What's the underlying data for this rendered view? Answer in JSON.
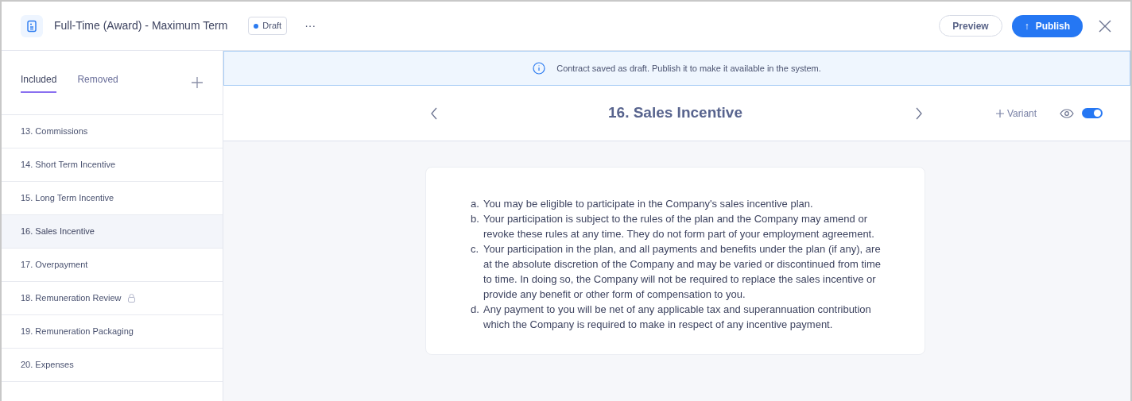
{
  "header": {
    "title": "Full-Time (Award) - Maximum Term",
    "status": "Draft",
    "more": "···",
    "preview": "Preview",
    "publish": "Publish",
    "publish_arrow": "↑"
  },
  "sidebar": {
    "tabs": [
      {
        "label": "Included",
        "selected": true
      },
      {
        "label": "Removed",
        "selected": false
      }
    ],
    "items": [
      {
        "label": "13. Commissions",
        "selected": false,
        "locked": false
      },
      {
        "label": "14. Short Term Incentive",
        "selected": false,
        "locked": false
      },
      {
        "label": "15. Long Term Incentive",
        "selected": false,
        "locked": false
      },
      {
        "label": "16. Sales Incentive",
        "selected": true,
        "locked": false
      },
      {
        "label": "17. Overpayment",
        "selected": false,
        "locked": false
      },
      {
        "label": "18. Remuneration Review",
        "selected": false,
        "locked": true
      },
      {
        "label": "19. Remuneration Packaging",
        "selected": false,
        "locked": false
      },
      {
        "label": "20. Expenses",
        "selected": false,
        "locked": false
      }
    ]
  },
  "banner": "Contract saved as draft. Publish it to make it available in the system.",
  "clause": {
    "title": "16. Sales Incentive",
    "variant": "Variant",
    "visible": true,
    "paragraphs": [
      {
        "marker": "a.",
        "text": "You may be eligible to participate in the Company's sales incentive plan."
      },
      {
        "marker": "b.",
        "text": "Your participation is subject to the rules of the plan and the Company may amend or revoke these rules at any time. They do not form part of your employment agreement."
      },
      {
        "marker": "c.",
        "text": "Your participation in the plan, and all payments and benefits under the plan (if any), are at the absolute discretion of the Company and may be varied or discontinued from time to time. In doing so, the Company will not be required to replace the sales incentive or provide any benefit or other form of compensation to you."
      },
      {
        "marker": "d.",
        "text": "Any payment to you will be net of any applicable tax and superannuation contribution which the Company is required to make in respect of any incentive payment."
      }
    ]
  }
}
